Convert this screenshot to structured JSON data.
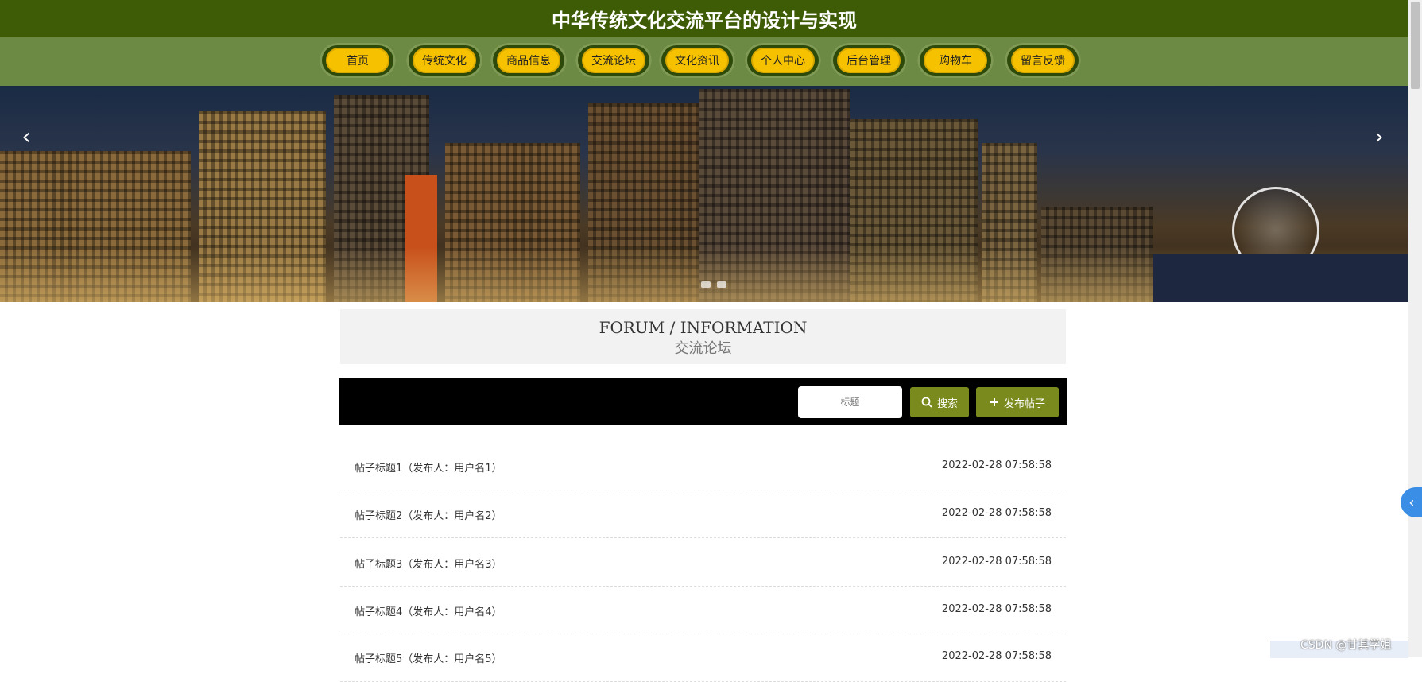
{
  "site": {
    "title": "中华传统文化交流平台的设计与实现"
  },
  "nav": {
    "items": [
      {
        "label": "首页"
      },
      {
        "label": "传统文化"
      },
      {
        "label": "商品信息"
      },
      {
        "label": "交流论坛"
      },
      {
        "label": "文化资讯"
      },
      {
        "label": "个人中心"
      },
      {
        "label": "后台管理"
      },
      {
        "label": "购物车"
      },
      {
        "label": "留言反馈"
      }
    ]
  },
  "carousel": {
    "prev_icon": "chevron-left-icon",
    "next_icon": "chevron-right-icon",
    "prev_glyph": "‹",
    "next_glyph": "›"
  },
  "section": {
    "title_en": "FORUM / INFORMATION",
    "title_cn": "交流论坛"
  },
  "toolbar": {
    "search_placeholder": "标题",
    "search_button": "搜索",
    "post_button": "发布帖子"
  },
  "posts": [
    {
      "title": "帖子标题1（发布人：用户名1）",
      "time": "2022-02-28 07:58:58"
    },
    {
      "title": "帖子标题2（发布人：用户名2）",
      "time": "2022-02-28 07:58:58"
    },
    {
      "title": "帖子标题3（发布人：用户名3）",
      "time": "2022-02-28 07:58:58"
    },
    {
      "title": "帖子标题4（发布人：用户名4）",
      "time": "2022-02-28 07:58:58"
    },
    {
      "title": "帖子标题5（发布人：用户名5）",
      "time": "2022-02-28 07:58:58"
    }
  ],
  "watermark": "CSDN @甘其学姐",
  "colors": {
    "header": "#3e5c06",
    "nav": "#6d8a45",
    "pill": "#f6c200",
    "button": "#7a8a1c"
  }
}
